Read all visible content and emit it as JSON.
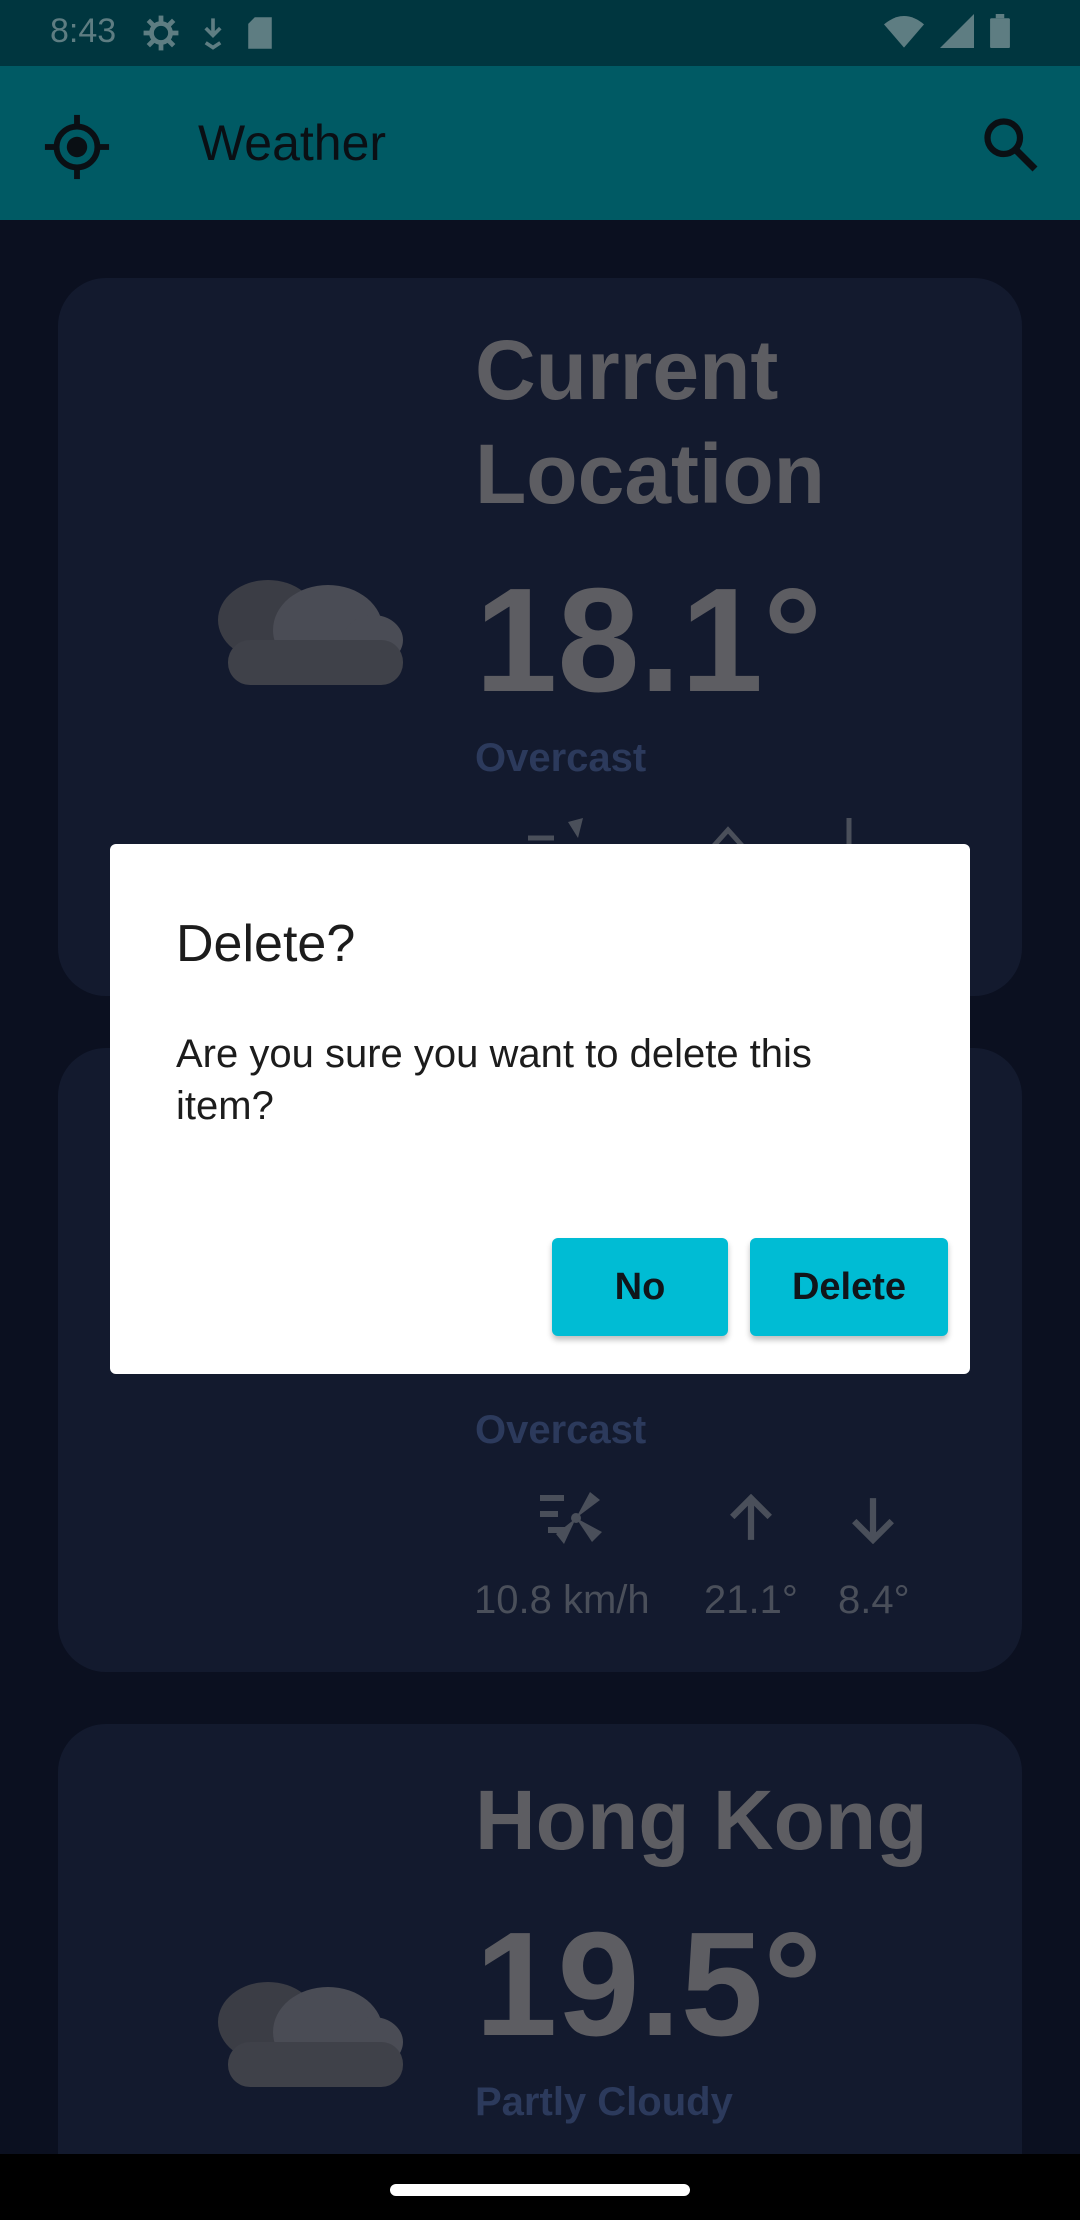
{
  "status_bar": {
    "time": "8:43",
    "icons_left": [
      "settings-icon",
      "download-icon",
      "sd-card-icon"
    ],
    "icons_right": [
      "wifi-icon",
      "signal-icon",
      "battery-icon"
    ]
  },
  "app_bar": {
    "title": "Weather",
    "left_icon": "location-icon",
    "right_icon": "search-icon",
    "color": "#005a64"
  },
  "cards": [
    {
      "city_line1": "Current",
      "city_line2": "Location",
      "temp": "18.1°",
      "condition": "Overcast"
    },
    {
      "condition": "Overcast",
      "wind": "10.8 km/h",
      "high": "21.1°",
      "low": "8.4°"
    },
    {
      "city": "Hong Kong",
      "temp": "19.5°",
      "condition": "Partly Cloudy"
    }
  ],
  "dialog": {
    "title": "Delete?",
    "message": "Are you sure you want to delete this item?",
    "no_label": "No",
    "delete_label": "Delete",
    "button_color": "#00bcd4"
  }
}
